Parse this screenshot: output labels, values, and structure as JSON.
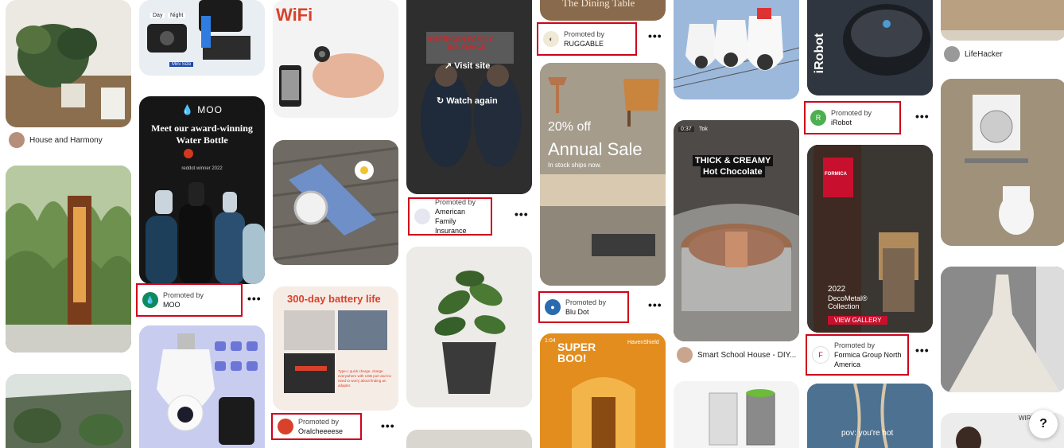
{
  "pins": {
    "house_harmony": {
      "source": "House and Harmony"
    },
    "moo": {
      "headline": "Meet our award-winning Water Bottle",
      "brand": "MOO",
      "award": "reddot winner 2022",
      "promoted_label": "Promoted by",
      "advertiser": "MOO"
    },
    "camera_top": {
      "badge_day": "Day",
      "badge_night": "Night",
      "badge_mini": "Mini Size"
    },
    "wifi": {
      "text": "WiFi"
    },
    "battery": {
      "headline": "300-day battery life",
      "caption": "Type-c quick charge, charge everywhere with USB port and no need to worry about finding an adapter.",
      "promoted_label": "Promoted by",
      "advertiser": "Oralcheeeese"
    },
    "american_family": {
      "logo_line1": "AMERICAN FAMILY",
      "logo_line2": "INSURANCE",
      "visit_site": "Visit site",
      "watch_again": "Watch again",
      "promoted_label": "Promoted by",
      "advertiser": "American Family Insurance"
    },
    "dining": {
      "title": "The Dining Table",
      "promoted_label": "Promoted by",
      "advertiser": "RUGGABLE"
    },
    "sale": {
      "pct": "20% off",
      "title": "Annual Sale",
      "sub": "In stock ships now.",
      "promoted_label": "Promoted by",
      "advertiser": "Blu Dot"
    },
    "superboo": {
      "title": "SUPER BOO!",
      "brand": "HavenShield",
      "counter": "1:04"
    },
    "cocoa": {
      "timer": "0:37",
      "tag": "Tok",
      "line1": "THICK & CREAMY",
      "line2": "Hot Chocolate",
      "source": "Smart School House - DIY..."
    },
    "irobot": {
      "logo": "iRobot",
      "promoted_label": "Promoted by",
      "advertiser": "iRobot"
    },
    "formica": {
      "year": "2022",
      "product": "DecoMetal® Collection",
      "cta": "VIEW GALLERY",
      "brand": "FORMICA",
      "promoted_label": "Promoted by",
      "advertiser": "Formica Group North America"
    },
    "pov": {
      "text": "pov: you're hot"
    },
    "lifehacker": {
      "source": "LifeHacker"
    },
    "wireless": {
      "text": "WIRELES"
    }
  },
  "more_label": "•••",
  "help_label": "?",
  "colors": {
    "promo_outline": "#d0021b",
    "moo_green": "#0e8a5f",
    "formica_red": "#c8102e",
    "battery_red": "#d9412a"
  }
}
